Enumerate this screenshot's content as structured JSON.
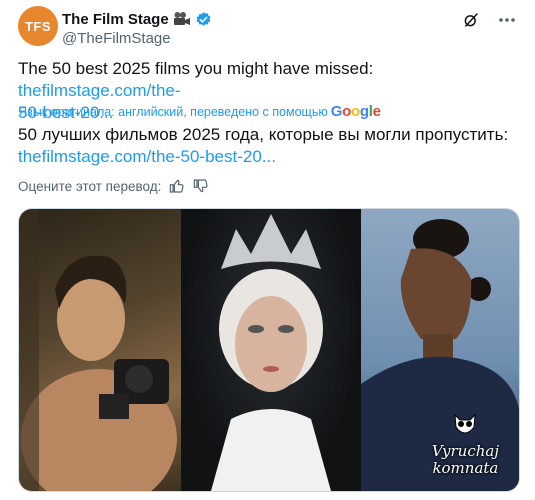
{
  "author": {
    "avatar_text": "TFS",
    "avatar_color": "#e8862e",
    "name": "The Film Stage",
    "handle": "@TheFilmStage",
    "verified": true
  },
  "icons": {
    "camera": "movie-camera-icon",
    "verified": "verified-badge-icon",
    "grok": "grok-icon",
    "more": "more-options-icon",
    "like": "thumbs-up-icon",
    "dislike": "thumbs-down-icon"
  },
  "tweet": {
    "text": "The 50 best 2025 films you might have missed: ",
    "link_line1": "thefilmstage.com/the-",
    "link_line2": "50-best-20..."
  },
  "translation": {
    "notice": "Язык оригинала: английский, переведено с помощью",
    "provider": "Google",
    "text": "50 лучших фильмов 2025 года, которые вы могли пропустить:",
    "link": "thefilmstage.com/the-50-best-20..."
  },
  "rating": {
    "label": "Оцените этот перевод:"
  },
  "media": {
    "panels": [
      "panel-1",
      "panel-2",
      "panel-3"
    ],
    "watermark_line1": "Vyruchaj",
    "watermark_line2": "komnata"
  },
  "colors": {
    "accent": "#1d9bf0",
    "text": "#0f1419",
    "secondary": "#536471"
  }
}
